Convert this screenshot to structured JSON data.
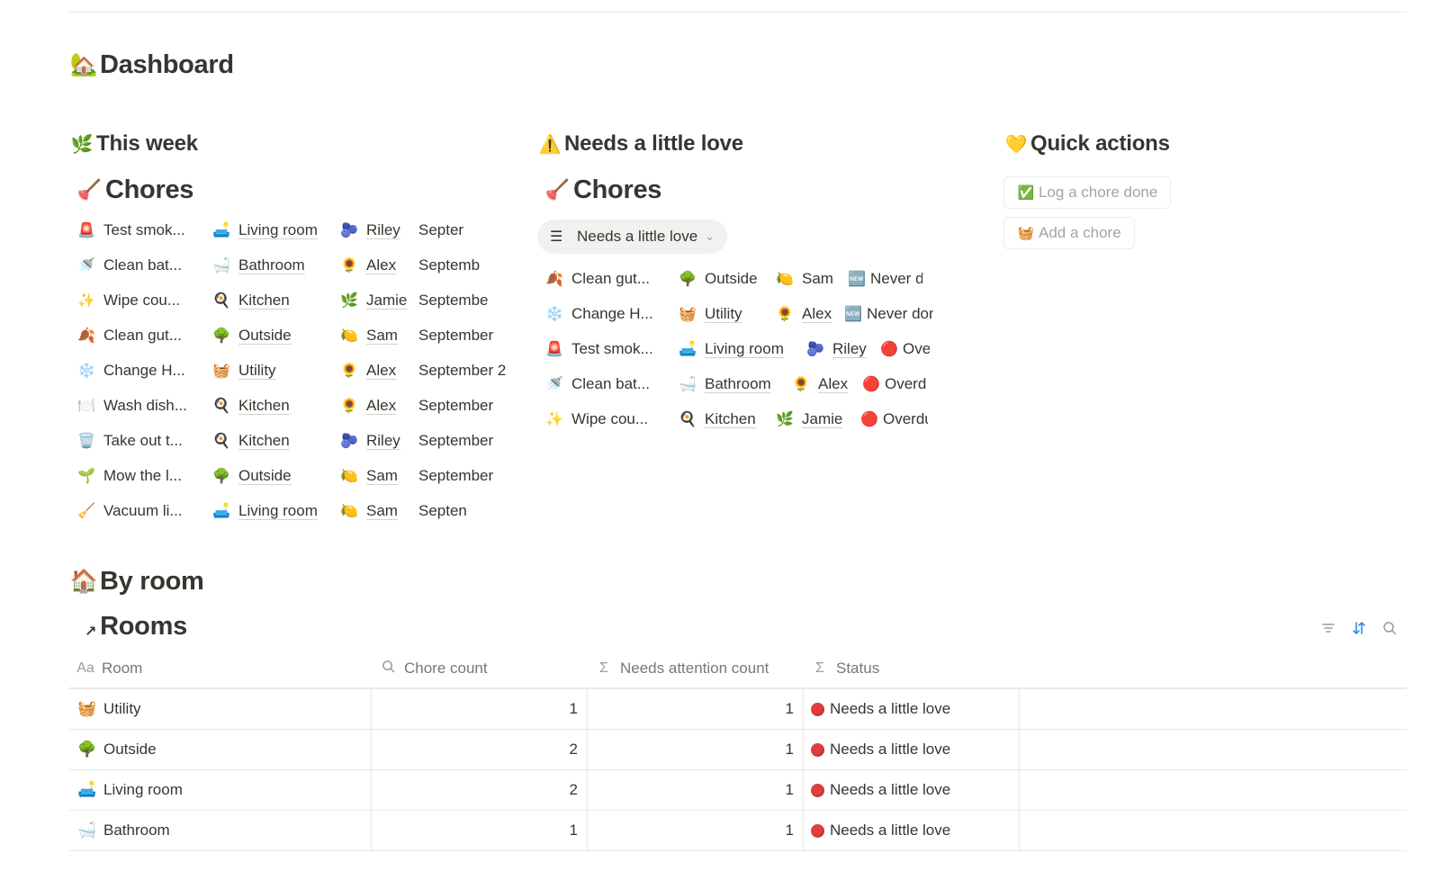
{
  "page": {
    "title": "Dashboard",
    "title_icon": "🏡"
  },
  "this_week": {
    "heading": "This week",
    "heading_icon": "🌿",
    "db_title": "Chores",
    "db_icon": "🪠",
    "rows": [
      {
        "title": "Test smok...",
        "title_icon": "🚨",
        "room": "Living room",
        "room_icon": "🛋️",
        "person": "Riley",
        "person_icon": "🫐",
        "date": "Septer"
      },
      {
        "title": "Clean bat...",
        "title_icon": "🚿",
        "room": "Bathroom",
        "room_icon": "🛁",
        "person": "Alex",
        "person_icon": "🌻",
        "date": "Septemb"
      },
      {
        "title": "Wipe cou...",
        "title_icon": "✨",
        "room": "Kitchen",
        "room_icon": "🍳",
        "person": "Jamie",
        "person_icon": "🌿",
        "date": "Septembe"
      },
      {
        "title": "Clean gut...",
        "title_icon": "🍂",
        "room": "Outside",
        "room_icon": "🌳",
        "person": "Sam",
        "person_icon": "🍋",
        "date": "September"
      },
      {
        "title": "Change H...",
        "title_icon": "❄️",
        "room": "Utility",
        "room_icon": "🧺",
        "person": "Alex",
        "person_icon": "🌻",
        "date": "September 2"
      },
      {
        "title": "Wash dish...",
        "title_icon": "🍽️",
        "room": "Kitchen",
        "room_icon": "🍳",
        "person": "Alex",
        "person_icon": "🌻",
        "date": "September"
      },
      {
        "title": "Take out t...",
        "title_icon": "🗑️",
        "room": "Kitchen",
        "room_icon": "🍳",
        "person": "Riley",
        "person_icon": "🫐",
        "date": "September"
      },
      {
        "title": "Mow the l...",
        "title_icon": "🌱",
        "room": "Outside",
        "room_icon": "🌳",
        "person": "Sam",
        "person_icon": "🍋",
        "date": "September"
      },
      {
        "title": "Vacuum li...",
        "title_icon": "🧹",
        "room": "Living room",
        "room_icon": "🛋️",
        "person": "Sam",
        "person_icon": "🍋",
        "date": "Septen"
      }
    ]
  },
  "needs_love": {
    "heading": "Needs a little love",
    "heading_icon": "⚠️",
    "db_title": "Chores",
    "db_icon": "🪠",
    "view_label": "Needs a little love",
    "view_icon": "list-icon",
    "rows": [
      {
        "title": "Clean gut...",
        "title_icon": "🍂",
        "room": "Outside",
        "room_icon": "🌳",
        "person": "Sam",
        "person_icon": "🍋",
        "status": "Never d",
        "status_icon": "🆕"
      },
      {
        "title": "Change H...",
        "title_icon": "❄️",
        "room": "Utility",
        "room_icon": "🧺",
        "person": "Alex",
        "person_icon": "🌻",
        "status": "Never don",
        "status_icon": "🆕"
      },
      {
        "title": "Test smok...",
        "title_icon": "🚨",
        "room": "Living room",
        "room_icon": "🛋️",
        "person": "Riley",
        "person_icon": "🫐",
        "status": "Ove",
        "status_icon": "🔴"
      },
      {
        "title": "Clean bat...",
        "title_icon": "🚿",
        "room": "Bathroom",
        "room_icon": "🛁",
        "person": "Alex",
        "person_icon": "🌻",
        "status": "Overd",
        "status_icon": "🔴"
      },
      {
        "title": "Wipe cou...",
        "title_icon": "✨",
        "room": "Kitchen",
        "room_icon": "🍳",
        "person": "Jamie",
        "person_icon": "🌿",
        "status": "Overdu",
        "status_icon": "🔴"
      }
    ]
  },
  "quick_actions": {
    "heading": "Quick actions",
    "heading_icon": "💛",
    "buttons": [
      {
        "label": "Log a chore done",
        "icon": "✅"
      },
      {
        "label": "Add a chore",
        "icon": "🧺"
      }
    ]
  },
  "by_room": {
    "heading": "By room",
    "heading_icon": "🏠",
    "db_title": "Rooms",
    "columns": [
      {
        "label": "Room",
        "icon": "Aa"
      },
      {
        "label": "Chore count",
        "icon": "🔍"
      },
      {
        "label": "Needs attention count",
        "icon": "Σ"
      },
      {
        "label": "Status",
        "icon": "Σ"
      }
    ],
    "rows": [
      {
        "room": "Utility",
        "icon": "🧺",
        "chore_count": "1",
        "needs_attention": "1",
        "status": "Needs a little love"
      },
      {
        "room": "Outside",
        "icon": "🌳",
        "chore_count": "2",
        "needs_attention": "1",
        "status": "Needs a little love"
      },
      {
        "room": "Living room",
        "icon": "🛋️",
        "chore_count": "2",
        "needs_attention": "1",
        "status": "Needs a little love"
      },
      {
        "room": "Bathroom",
        "icon": "🛁",
        "chore_count": "1",
        "needs_attention": "1",
        "status": "Needs a little love"
      }
    ],
    "status_color": "#e03e3e"
  }
}
